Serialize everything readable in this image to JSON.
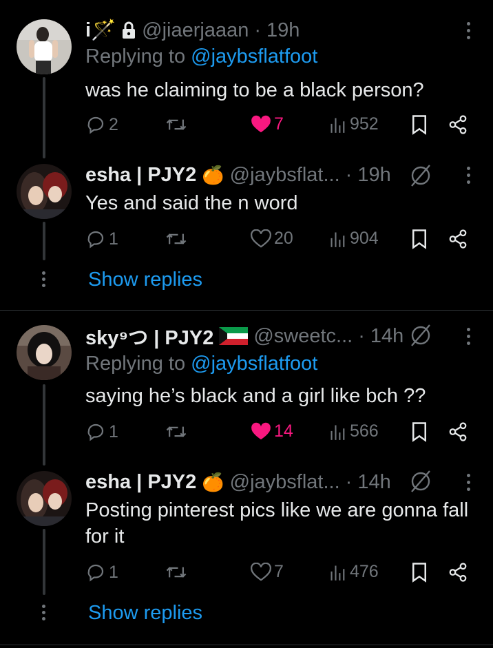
{
  "tweets": [
    {
      "name": "i🪄",
      "handle": "@jiaerjaaan",
      "dot": "·",
      "time": "19h",
      "replying_prefix": "Replying to",
      "replying_to": "@jaybsflatfoot",
      "text": "was he claiming to be a black person?",
      "replies": "2",
      "retweets": "",
      "likes": "7",
      "views": "952"
    },
    {
      "name": "esha | PJY2",
      "name_emoji": "🍊",
      "handle": "@jaybsflat...",
      "dot": "·",
      "time": "19h",
      "text": "Yes and said the n word",
      "replies": "1",
      "retweets": "",
      "likes": "20",
      "views": "904"
    },
    {
      "name": "sky⁹つ | PJY2",
      "handle": "@sweetc...",
      "dot": "·",
      "time": "14h",
      "replying_prefix": "Replying to",
      "replying_to": "@jaybsflatfoot",
      "text": "saying he’s black and a girl like bch ??",
      "replies": "1",
      "retweets": "",
      "likes": "14",
      "views": "566"
    },
    {
      "name": "esha | PJY2",
      "name_emoji": "🍊",
      "handle": "@jaybsflat...",
      "dot": "·",
      "time": "14h",
      "text": "Posting pinterest pics like we are gonna fall for it",
      "replies": "1",
      "retweets": "",
      "likes": "7",
      "views": "476"
    }
  ],
  "show_replies_label": "Show replies",
  "colors": {
    "background": "#000000",
    "text": "#e7e9ea",
    "muted": "#71767b",
    "link": "#1d9bf0",
    "like_active": "#f91880",
    "divider": "#2f3336"
  },
  "icons": [
    "reply-icon",
    "retweet-icon",
    "like-icon",
    "views-icon",
    "bookmark-icon",
    "share-icon",
    "more-icon",
    "lock-icon",
    "no-reply-icon"
  ]
}
